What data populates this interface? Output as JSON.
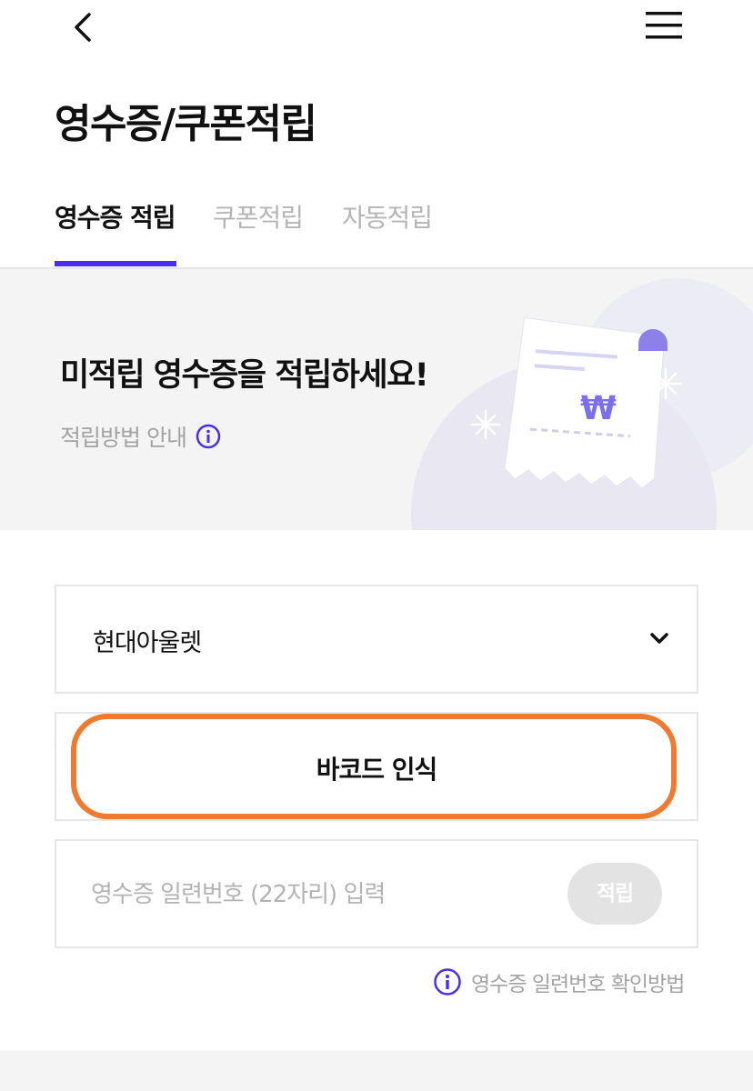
{
  "header": {
    "back_icon": "chevron-left-icon",
    "menu_icon": "hamburger-menu-icon",
    "title": "영수증/쿠폰적립"
  },
  "tabs": [
    {
      "label": "영수증 적립",
      "active": true
    },
    {
      "label": "쿠폰적립",
      "active": false
    },
    {
      "label": "자동적립",
      "active": false
    }
  ],
  "banner": {
    "title": "미적립 영수증을 적립하세요!",
    "guide_label": "적립방법 안내",
    "guide_icon": "info-icon",
    "illustration_icon": "receipt-won-icon",
    "won_symbol": "₩"
  },
  "form": {
    "store_select": {
      "selected": "현대아울렛",
      "icon": "chevron-down-icon"
    },
    "barcode_button_label": "바코드 인식",
    "serial_input": {
      "placeholder": "영수증 일련번호 (22자리) 입력",
      "value": ""
    },
    "submit_label": "적립",
    "help_label": "영수증 일련번호 확인방법",
    "help_icon": "info-icon"
  },
  "colors": {
    "accent": "#4a2df0",
    "highlight": "#f07a30",
    "muted_text": "#a3a3a3",
    "banner_bg": "#f4f4f4",
    "border": "#e6e6e6"
  }
}
